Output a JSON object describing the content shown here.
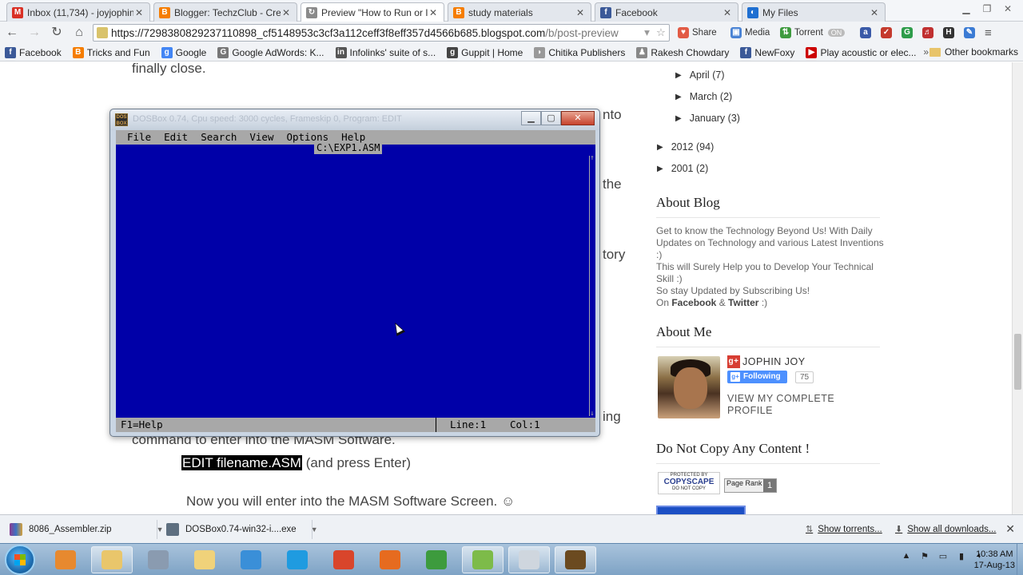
{
  "tabs": [
    {
      "title": "Inbox (11,734) - joyjophin@",
      "favicon": "gmail-icon",
      "color": "#d93025",
      "glyph": "M",
      "active": false
    },
    {
      "title": "Blogger: TechzClub - Crea",
      "favicon": "blogger-icon",
      "color": "#f57d00",
      "glyph": "B",
      "active": false
    },
    {
      "title": "Preview \"How to Run or In",
      "favicon": "loading-icon",
      "color": "#8a8a8a",
      "glyph": "↻",
      "active": true
    },
    {
      "title": "study materials",
      "favicon": "blogger-icon",
      "color": "#f57d00",
      "glyph": "B",
      "active": false
    },
    {
      "title": "Facebook",
      "favicon": "facebook-icon",
      "color": "#3b5998",
      "glyph": "f",
      "active": false
    },
    {
      "title": "My Files",
      "favicon": "mediafire-icon",
      "color": "#1f6fd1",
      "glyph": "◐",
      "active": false
    }
  ],
  "toolbar": {
    "url_main": "https://729838082923711089​8_cf5148953c3cf3a112ceff3f8eff357d4566b685.blogspot.com",
    "url_tail": "/b/post-preview",
    "share_label": "Share",
    "media_label": "Media",
    "torrent_label": "Torrent",
    "torrent_badge": "ON"
  },
  "bookmarks": [
    {
      "label": "Facebook",
      "icon": "facebook-icon",
      "color": "#3b5998",
      "glyph": "f"
    },
    {
      "label": "Tricks and Fun",
      "icon": "blogger-icon",
      "color": "#f57d00",
      "glyph": "B"
    },
    {
      "label": "Google",
      "icon": "google-icon",
      "color": "#4285f4",
      "glyph": "g"
    },
    {
      "label": "Google AdWords: K...",
      "icon": "adwords-icon",
      "color": "#777777",
      "glyph": "G"
    },
    {
      "label": "Infolinks' suite of s...",
      "icon": "infolinks-icon",
      "color": "#555555",
      "glyph": "in"
    },
    {
      "label": "Guppit | Home",
      "icon": "guppit-icon",
      "color": "#444444",
      "glyph": "g"
    },
    {
      "label": "Chitika Publishers",
      "icon": "chitika-icon",
      "color": "#999999",
      "glyph": "◗"
    },
    {
      "label": "Rakesh Chowdary",
      "icon": "person-icon",
      "color": "#888888",
      "glyph": "♟"
    },
    {
      "label": "NewFoxy",
      "icon": "facebook-icon",
      "color": "#3b5998",
      "glyph": "f"
    },
    {
      "label": "Play acoustic or elec...",
      "icon": "youtube-icon",
      "color": "#cc0000",
      "glyph": "▶"
    }
  ],
  "bookmarks_more": "»",
  "bookmarks_other": "Other bookmarks",
  "post": {
    "line_close": "finally close.",
    "frag_1": "nto",
    "frag_2": "the",
    "frag_3": "tory",
    "frag_4": "ing",
    "line_cmd": "command to enter into the MASM Software.",
    "edit_cmd": "EDIT filename.ASM",
    "edit_rest": " (and press Enter)",
    "line_enter": "Now you will enter into the MASM Software Screen. ☺"
  },
  "sidebar": {
    "archive": [
      {
        "label": "April",
        "count": "(7)"
      },
      {
        "label": "March",
        "count": "(2)"
      },
      {
        "label": "January",
        "count": "(3)"
      },
      {
        "label": "2012",
        "count": "(94)"
      },
      {
        "label": "2001",
        "count": "(2)"
      }
    ],
    "about_blog_heading": "About Blog",
    "about_blog_text_1": "Get to know the Technology Beyond Us! With Daily Updates on Technology and various Latest Inventions :)",
    "about_blog_text_2": "This will Surely Help you to Develop Your Technical Skill :)",
    "about_blog_text_3": "So stay Updated by Subscribing Us!",
    "about_blog_on": "On ",
    "about_blog_fb": "Facebook",
    "about_blog_amp": " & ",
    "about_blog_tw": "Twitter",
    "about_blog_end": " :)",
    "about_me_heading": "About Me",
    "profile_name": "JOPHIN JOY",
    "following_label": "Following",
    "follower_count": "75",
    "view_profile": "VIEW MY COMPLETE PROFILE",
    "no_copy_heading": "Do Not Copy Any Content !",
    "copyscape_top": "PROTECTED BY",
    "copyscape_main": "COPYSCAPE",
    "copyscape_bottom": "DO NOT COPY",
    "pagerank_label": "Page Rank",
    "pagerank_value": "1"
  },
  "dosbox": {
    "title": "DOSBox 0.74, Cpu speed:   3000 cycles, Frameskip  0, Program:    EDIT",
    "menu": [
      "File",
      "Edit",
      "Search",
      "View",
      "Options",
      "Help"
    ],
    "filename": "C:\\EXP1.ASM",
    "status_help": "F1=Help",
    "status_line": "Line:1",
    "status_col": "Col:1",
    "colors": {
      "screen": "#0000a8",
      "chrome": "#a8a8a8"
    }
  },
  "downloads": {
    "items": [
      {
        "name": "8086_Assembler.zip",
        "icon": "winrar-icon"
      },
      {
        "name": "DOSBox0.74-win32-i....exe",
        "icon": "installer-icon"
      }
    ],
    "show_torrents": "Show torrents...",
    "show_all": "Show all downloads...",
    "close": "✕"
  },
  "taskbar": {
    "apps": [
      {
        "name": "media-player-icon",
        "color": "#e7892f"
      },
      {
        "name": "file-explorer-icon",
        "color": "#e9c66b"
      },
      {
        "name": "network-icon",
        "color": "#8a9bb0"
      },
      {
        "name": "folder-icon",
        "color": "#f0d27a"
      },
      {
        "name": "internet-explorer-icon",
        "color": "#3a8fd8"
      },
      {
        "name": "windows-store-icon",
        "color": "#1f9be0"
      },
      {
        "name": "ccleaner-icon",
        "color": "#d9452b"
      },
      {
        "name": "firefox-icon",
        "color": "#e66b1f"
      },
      {
        "name": "chrome-icon",
        "color": "#3d9b3d"
      },
      {
        "name": "notepad-plus-icon",
        "color": "#7dbb49"
      },
      {
        "name": "dos-window-icon",
        "color": "#cfd6de"
      },
      {
        "name": "dosbox-icon",
        "color": "#6b4a20"
      }
    ],
    "time": "10:38 AM",
    "date": "17-Aug-13"
  }
}
